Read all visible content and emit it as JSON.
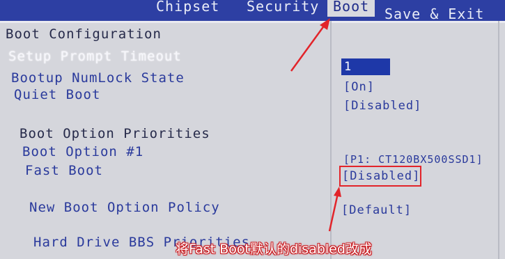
{
  "menu": {
    "tabs": [
      {
        "label": "Chipset"
      },
      {
        "label": "Security"
      },
      {
        "label": "Boot"
      },
      {
        "label": "Save & Exit"
      }
    ]
  },
  "boot": {
    "title": "Boot Configuration",
    "setup_prompt_timeout": {
      "label": "Setup Prompt Timeout",
      "value": "1"
    },
    "numlock": {
      "label": "Bootup NumLock State",
      "value": "[On]"
    },
    "quiet_boot": {
      "label": "Quiet Boot",
      "value": "[Disabled]"
    },
    "priorities_header": "Boot Option Priorities",
    "boot_option_1": {
      "label": "Boot Option #1",
      "value": "[P1: CT120BX500SSD1]"
    },
    "fast_boot": {
      "label": "Fast Boot",
      "value": "[Disabled]"
    },
    "new_boot_policy": {
      "label": "New Boot Option Policy",
      "value": "[Default]"
    },
    "hdd_bbs": {
      "label": "Hard Drive BBS Priorities"
    }
  },
  "annotation": {
    "caption": "将Fast Boot默认的disabled改成",
    "color": "#e2242a"
  },
  "colors": {
    "menubar_bg": "#2d3fa3",
    "screen_bg": "#d5d6dc",
    "text_blue": "#2a3a9c",
    "field_bg": "#1e38a8"
  }
}
